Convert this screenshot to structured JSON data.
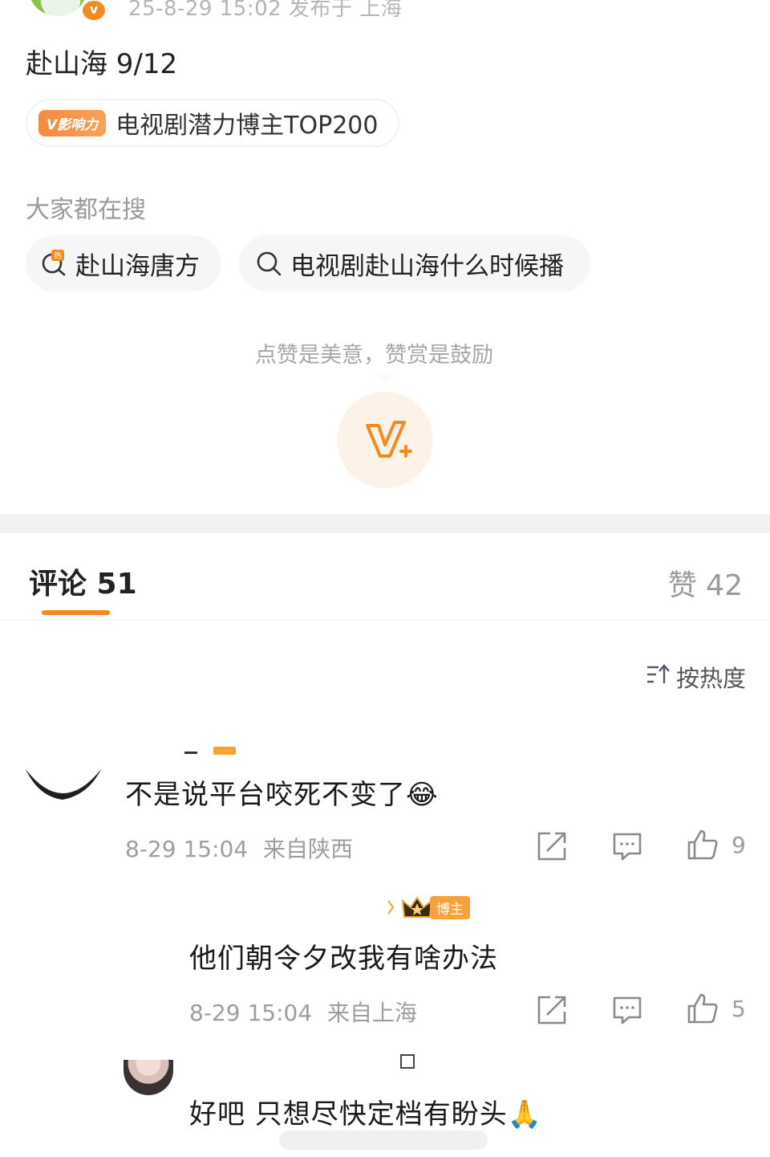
{
  "post": {
    "meta_top": "25-8-29 15:02  发布于 上海",
    "text": "赴山海 9/12",
    "badge_tag": "V影响力",
    "badge_text": "电视剧潜力博主TOP200"
  },
  "search": {
    "title": "大家都在搜",
    "chips": [
      {
        "label": "赴山海唐方",
        "icon": "hot-search-icon"
      },
      {
        "label": "电视剧赴山海什么时候播",
        "icon": "search-icon"
      }
    ]
  },
  "reward": {
    "text": "点赞是美意，赞赏是鼓励",
    "button_icon": "v-plus-reward-icon"
  },
  "tabs": {
    "comments_label": "评论 51",
    "likes_label": "赞 42"
  },
  "sort": {
    "label": "按热度"
  },
  "comments": [
    {
      "text": "不是说平台咬死不变了😂",
      "time": "8-29 15:04",
      "location": "来自陕西",
      "likes": "9"
    },
    {
      "tag": "博主",
      "text": "他们朝令夕改我有啥办法",
      "time": "8-29 15:04",
      "location": "来自上海",
      "likes": "5"
    },
    {
      "text": "好吧 只想尽快定档有盼头🙏"
    }
  ],
  "colors": {
    "accent": "#f28a1d",
    "muted_text": "#9e9e9e",
    "chip_bg": "#f6f6f6"
  }
}
